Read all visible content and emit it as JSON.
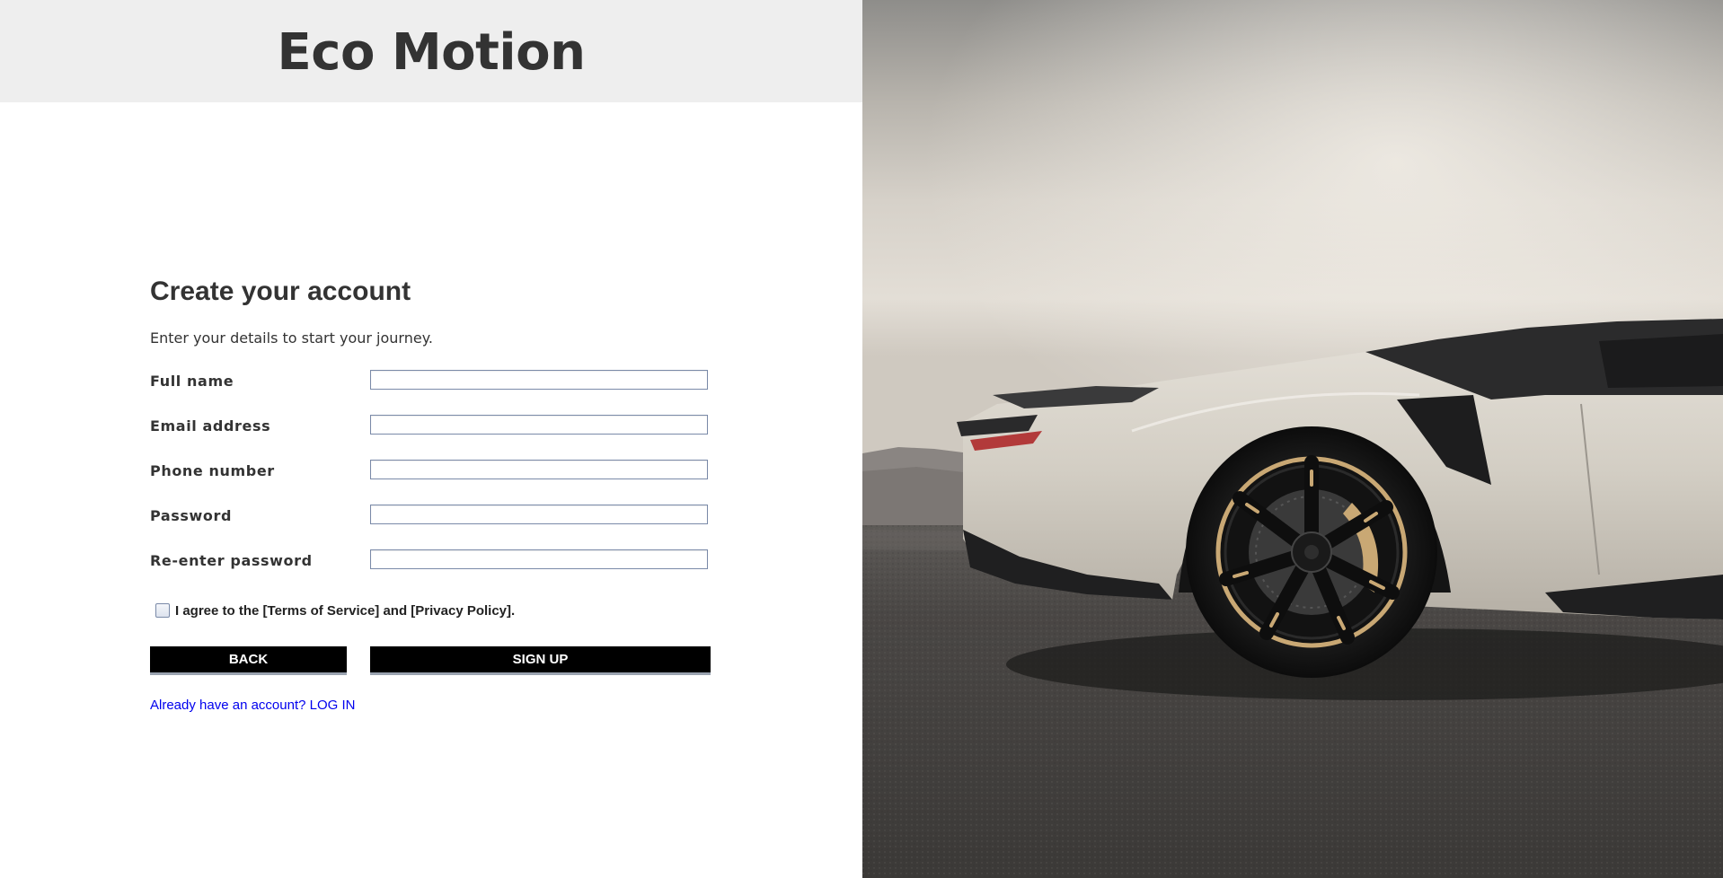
{
  "header": {
    "brand": "Eco Motion"
  },
  "form": {
    "title": "Create your account",
    "subtitle": "Enter your details to start your journey.",
    "fields": [
      {
        "label": "Full name",
        "value": "",
        "placeholder": ""
      },
      {
        "label": "Email address",
        "value": "",
        "placeholder": ""
      },
      {
        "label": "Phone number",
        "value": "",
        "placeholder": ""
      },
      {
        "label": "Password",
        "value": "",
        "placeholder": ""
      },
      {
        "label": "Re-enter password",
        "value": "",
        "placeholder": ""
      }
    ],
    "agree_text": "I agree to the [Terms of Service] and [Privacy Policy].",
    "agree_checked": false,
    "back_label": "BACK",
    "signup_label": "SIGN UP",
    "login_link": "Already have an account? LOG IN"
  },
  "hero_image": {
    "subject": "white-sports-car-photo"
  },
  "colors": {
    "header_bg": "#eeeeee",
    "text": "#333333",
    "button_bg": "#000000",
    "button_text": "#ffffff",
    "link": "#0000ee"
  }
}
